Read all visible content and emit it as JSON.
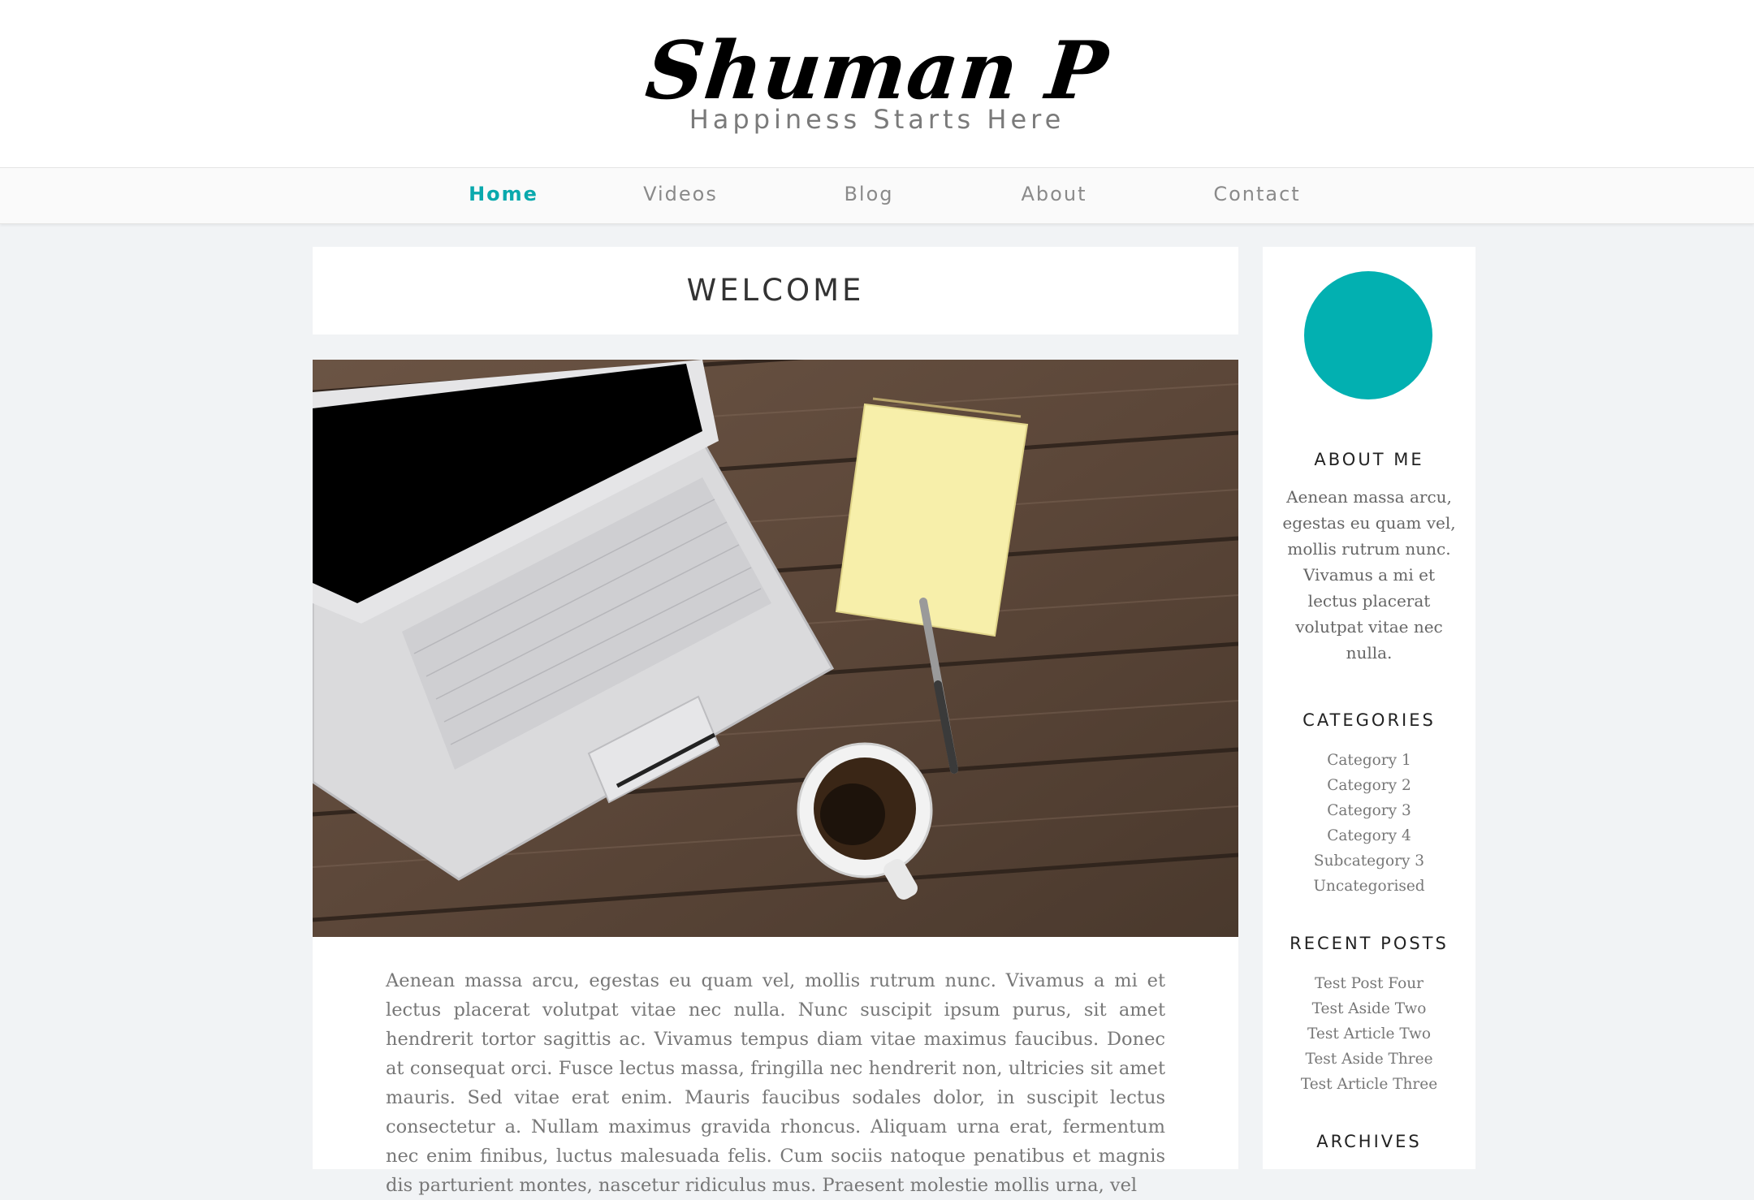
{
  "header": {
    "title": "Shuman P",
    "tagline": "Happiness Starts Here"
  },
  "nav": {
    "items": [
      "Home",
      "Videos",
      "Blog",
      "About",
      "Contact"
    ],
    "active": "Home"
  },
  "page": {
    "title": "WELCOME",
    "hero_image": "laptop-notepad-coffee-photo",
    "body": "Aenean massa arcu, egestas eu quam vel, mollis rutrum nunc. Vivamus a mi et lectus placerat volutpat vitae nec nulla. Nunc suscipit ipsum purus, sit amet hendrerit tortor sagittis ac. Vivamus tempus diam vitae maximus faucibus. Donec at consequat orci. Fusce lectus massa, fringilla nec hendrerit non, ultricies sit amet mauris. Sed vitae erat enim. Mauris faucibus sodales dolor, in suscipit lectus consectetur a. Nullam maximus gravida rhoncus. Aliquam urna erat, fermentum nec enim finibus, luctus malesuada felis. Cum sociis natoque penatibus et magnis dis parturient montes, nascetur ridiculus mus. Praesent molestie mollis urna, vel"
  },
  "sidebar": {
    "about": {
      "title": "ABOUT ME",
      "text": "Aenean massa arcu, egestas eu quam vel, mollis rutrum nunc. Vivamus a mi et lectus placerat volutpat vitae nec nulla."
    },
    "categories": {
      "title": "CATEGORIES",
      "items": [
        "Category 1",
        "Category 2",
        "Category 3",
        "Category 4",
        "Subcategory 3",
        "Uncategorised"
      ]
    },
    "recent_posts": {
      "title": "RECENT POSTS",
      "items": [
        "Test Post Four",
        "Test Aside Two",
        "Test Article Two",
        "Test Aside Three",
        "Test Article Three"
      ]
    },
    "archives": {
      "title": "ARCHIVES"
    }
  },
  "colors": {
    "accent": "#0aa9ad",
    "avatar": "#02b0b1",
    "background": "#f1f3f5"
  }
}
